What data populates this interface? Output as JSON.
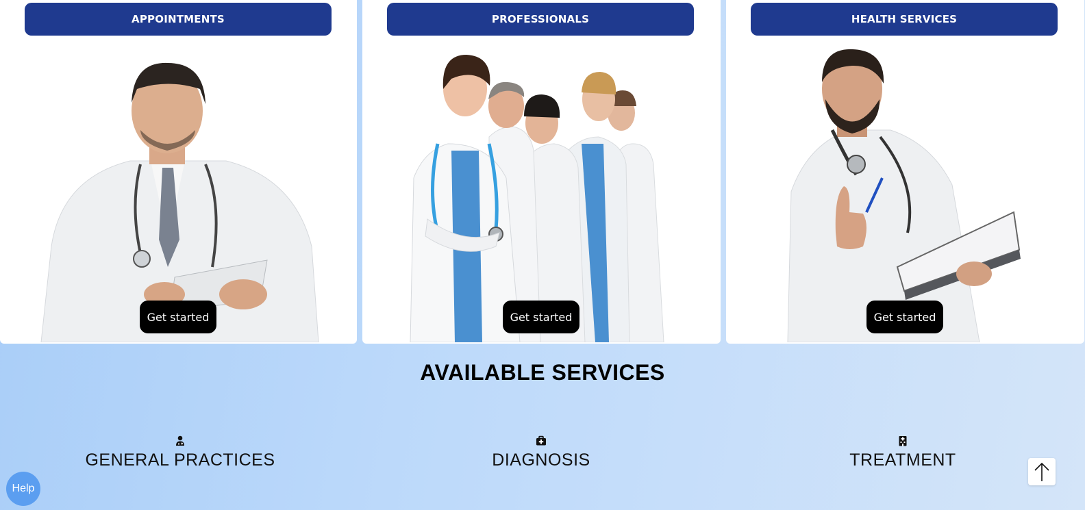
{
  "cards": [
    {
      "title": "APPOINTMENTS",
      "button": "Get started",
      "image": "doctor-with-tablet"
    },
    {
      "title": "PROFESSIONALS",
      "button": "Get started",
      "image": "group-of-doctors"
    },
    {
      "title": "HEALTH SERVICES",
      "button": "Get started",
      "image": "doctor-thumbs-up"
    }
  ],
  "services": {
    "title": "AVAILABLE SERVICES",
    "items": [
      {
        "label": "GENERAL PRACTICES",
        "icon": "user-doctor-icon"
      },
      {
        "label": "DIAGNOSIS",
        "icon": "medkit-icon"
      },
      {
        "label": "TREATMENT",
        "icon": "hospital-icon"
      }
    ]
  },
  "help": {
    "label": "Help"
  },
  "scroll_top": {
    "icon": "arrow-up-icon"
  },
  "colors": {
    "card_title_bg": "#1f3a8f",
    "button_bg": "#000000",
    "help_bg": "#5b9ef0",
    "page_bg_start": "#a8cdf8",
    "page_bg_end": "#d4e5f9"
  }
}
